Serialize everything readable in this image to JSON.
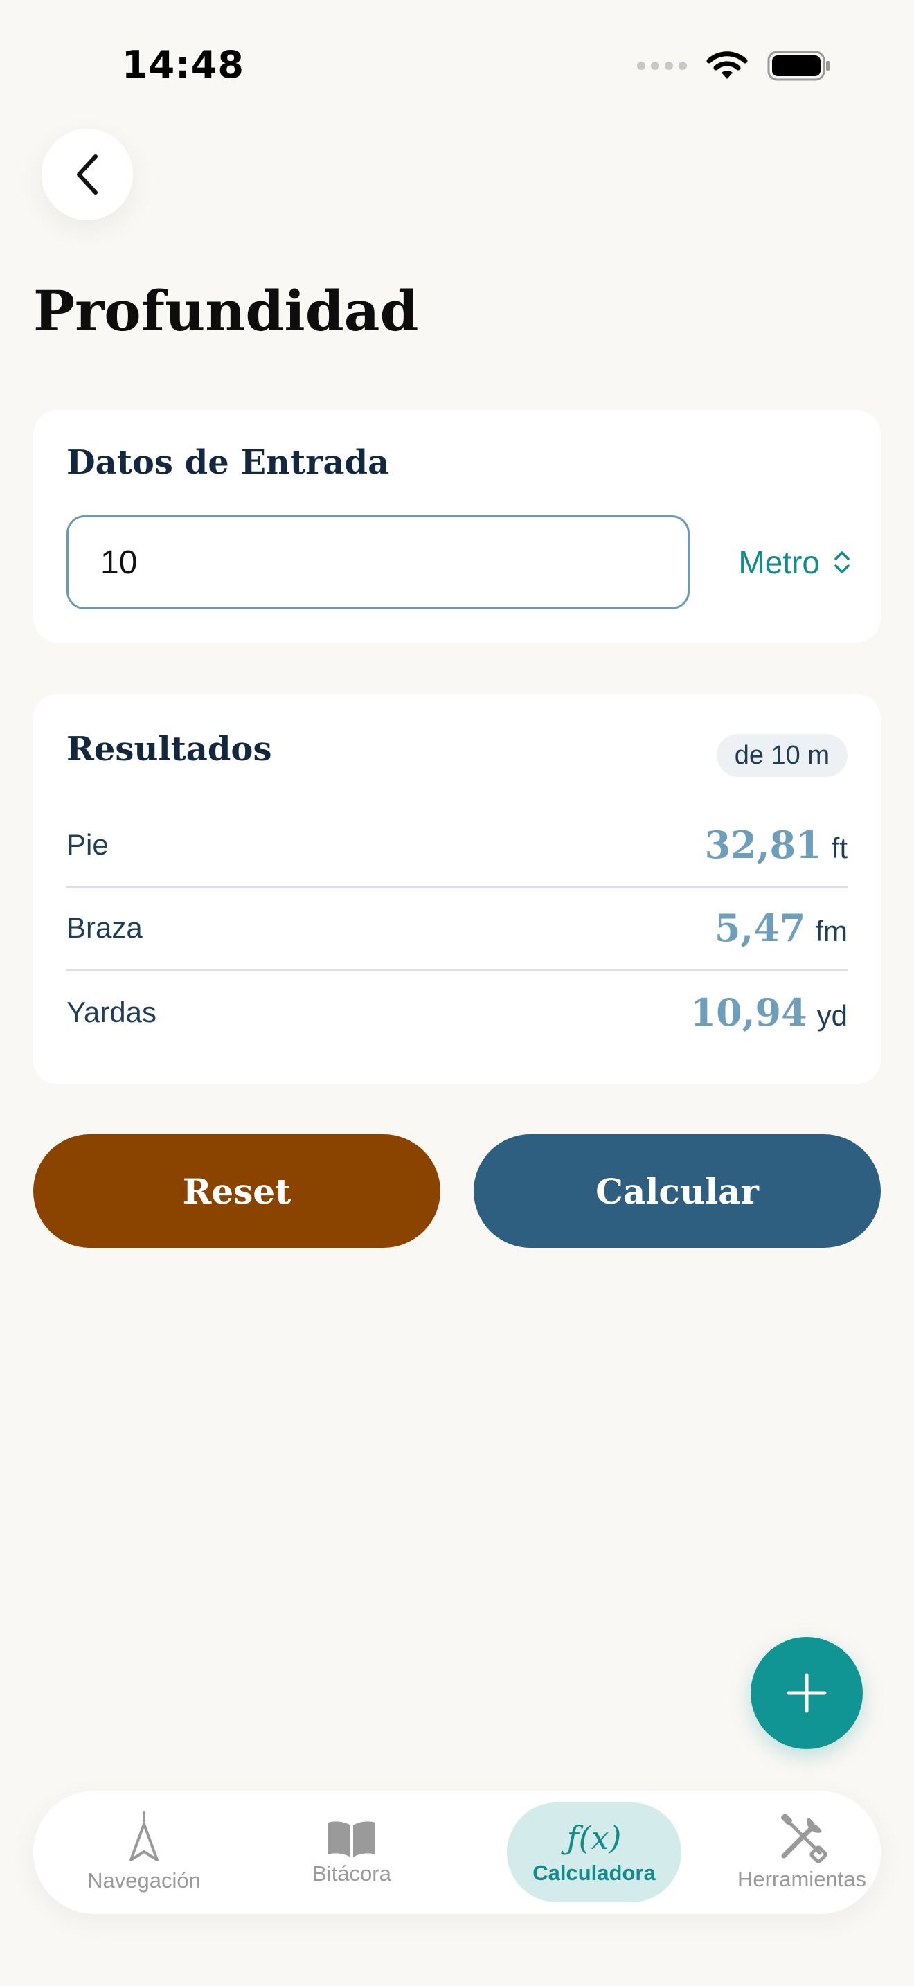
{
  "status": {
    "time": "14:48"
  },
  "page": {
    "title": "Profundidad"
  },
  "input_card": {
    "title": "Datos de Entrada",
    "value": "10",
    "unit": "Metro"
  },
  "results_card": {
    "title": "Resultados",
    "badge": "de 10 m",
    "rows": [
      {
        "label": "Pie",
        "value": "32,81",
        "unit": "ft"
      },
      {
        "label": "Braza",
        "value": "5,47",
        "unit": "fm"
      },
      {
        "label": "Yardas",
        "value": "10,94",
        "unit": "yd"
      }
    ]
  },
  "actions": {
    "reset": "Reset",
    "calculate": "Calcular"
  },
  "colors": {
    "reset_bg": "#8b4400",
    "calculate_bg": "#2e5f80",
    "accent": "#119494"
  },
  "tabs": [
    {
      "label": "Navegación",
      "icon": "compass-arrow-icon"
    },
    {
      "label": "Bitácora",
      "icon": "book-icon"
    },
    {
      "label": "Calculadora",
      "icon": "function-icon",
      "icon_text": "ƒ(x)",
      "active": true
    },
    {
      "label": "Herramientas",
      "icon": "tools-icon"
    }
  ]
}
